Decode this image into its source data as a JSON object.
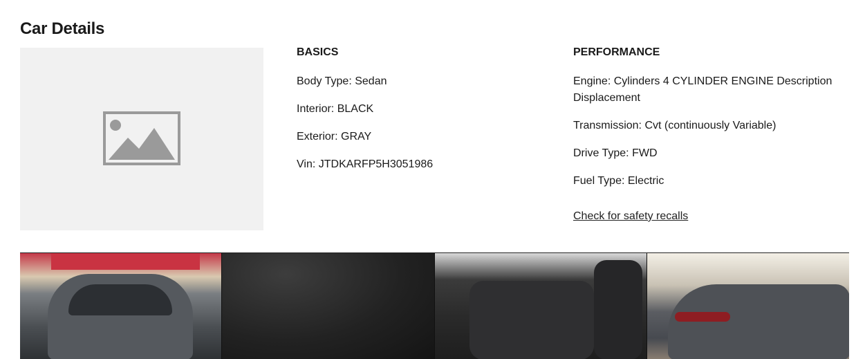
{
  "title": "Car Details",
  "basics": {
    "heading": "BASICS",
    "items": [
      {
        "label": "Body Type:",
        "value": "Sedan"
      },
      {
        "label": "Interior:",
        "value": "BLACK"
      },
      {
        "label": "Exterior:",
        "value": "GRAY"
      },
      {
        "label": "Vin:",
        "value": "JTDKARFP5H3051986"
      }
    ]
  },
  "performance": {
    "heading": "PERFORMANCE",
    "items": [
      {
        "label": "Engine:",
        "value": "Cylinders 4 CYLINDER ENGINE Description Displacement"
      },
      {
        "label": "Transmission:",
        "value": "Cvt (continuously Variable)"
      },
      {
        "label": "Drive Type:",
        "value": "FWD"
      },
      {
        "label": "Fuel Type:",
        "value": "Electric"
      }
    ],
    "recall_link": "Check for safety recalls"
  },
  "icons": {
    "placeholder": "image-placeholder-icon"
  },
  "colors": {
    "placeholder_bg": "#f1f1f1",
    "placeholder_icon": "#9a9a9a"
  }
}
